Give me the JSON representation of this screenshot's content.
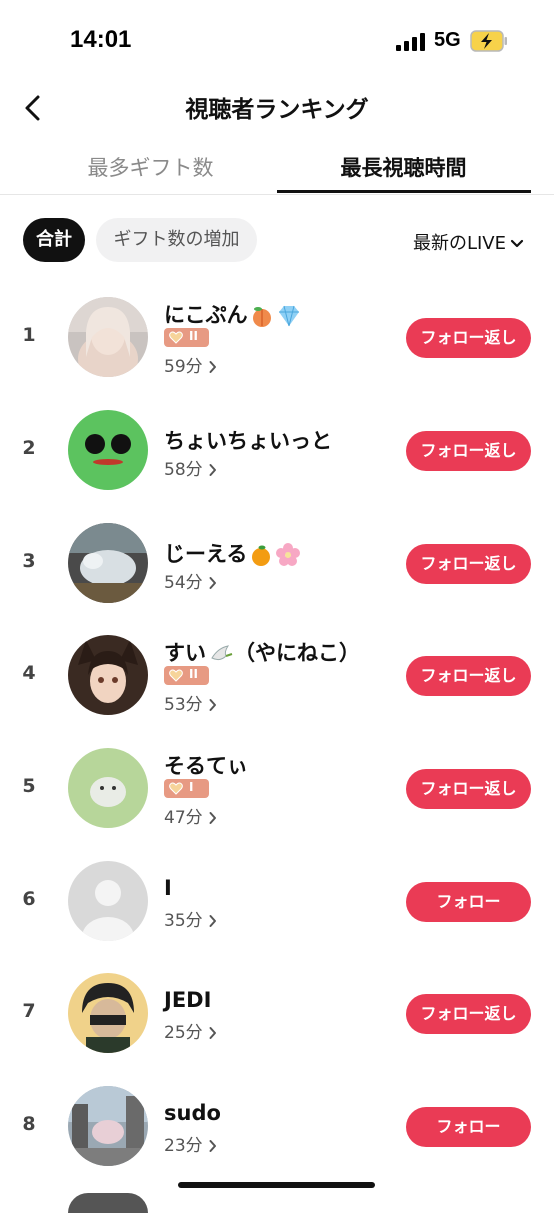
{
  "status": {
    "time": "14:01",
    "network": "5G"
  },
  "header": {
    "title": "視聴者ランキング"
  },
  "tabs": [
    {
      "label": "最多ギフト数"
    },
    {
      "label": "最長視聴時間"
    }
  ],
  "filters": {
    "total": "合計",
    "gift_increase": "ギフト数の増加",
    "sort": "最新のLIVE"
  },
  "rows": [
    {
      "rank": "1",
      "name": "にこぷん",
      "badge": "II",
      "duration": "59分",
      "button": "フォロー返し"
    },
    {
      "rank": "2",
      "name": "ちょいちょいっと",
      "duration": "58分",
      "button": "フォロー返し"
    },
    {
      "rank": "3",
      "name": "じーえる",
      "duration": "54分",
      "button": "フォロー返し"
    },
    {
      "rank": "4",
      "name": "すい",
      "name_suffix": "（やにねこ）",
      "badge": "II",
      "duration": "53分",
      "button": "フォロー返し"
    },
    {
      "rank": "5",
      "name": "そるてぃ",
      "badge": "I",
      "duration": "47分",
      "button": "フォロー返し"
    },
    {
      "rank": "6",
      "name": "I",
      "duration": "35分",
      "button": "フォロー"
    },
    {
      "rank": "7",
      "name": "JEDI",
      "duration": "25分",
      "button": "フォロー返し"
    },
    {
      "rank": "8",
      "name": "sudo",
      "duration": "23分",
      "button": "フォロー"
    }
  ],
  "colors": {
    "accent": "#ea3b55",
    "badge": "#e79a83"
  },
  "icons": [
    "back-arrow-icon",
    "chevron-down-icon",
    "chevron-right-icon",
    "heart-icon",
    "signal-icon",
    "battery-charging-icon"
  ]
}
